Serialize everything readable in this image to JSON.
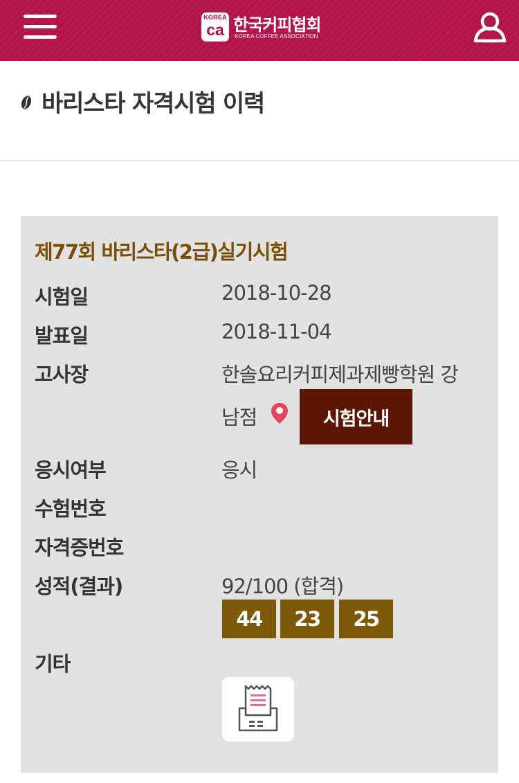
{
  "header": {
    "logo_mark_top": "KOREA",
    "logo_mark_main": "ca",
    "logo_name_ko": "한국커피협회",
    "logo_name_en": "KOREA COFFEE ASSOCIATION",
    "menu_icon": "hamburger-menu-icon",
    "user_icon": "user-icon",
    "brand_color": "#b3124a"
  },
  "page": {
    "title": "바리스타 자격시험 이력",
    "title_icon": "coffee-bean-icon"
  },
  "exam": {
    "title": "제77회 바리스타(2급)실기시험",
    "rows": {
      "exam_date": {
        "label": "시험일",
        "value": "2018-10-28"
      },
      "announce_date": {
        "label": "발표일",
        "value": "2018-11-04"
      },
      "venue": {
        "label": "고사장",
        "value_line1": "한솔요리커피제과제빵학원 강",
        "value_line2": "남점"
      },
      "attendance": {
        "label": "응시여부",
        "value": "응시"
      },
      "exam_number": {
        "label": "수험번호",
        "value": ""
      },
      "cert_number": {
        "label": "자격증번호",
        "value": ""
      },
      "result": {
        "label": "성적(결과)",
        "value": "92/100 (합격)"
      },
      "etc": {
        "label": "기타"
      }
    },
    "venue_guide_button": "시험안내",
    "location_icon": "map-pin-icon",
    "scores": [
      "44",
      "23",
      "25"
    ],
    "receipt_icon": "receipt-print-icon",
    "colors": {
      "title": "#7a4e08",
      "score_box": "#7c5909",
      "guide_button": "#5b1605",
      "card_bg": "#e2e2e2"
    }
  }
}
